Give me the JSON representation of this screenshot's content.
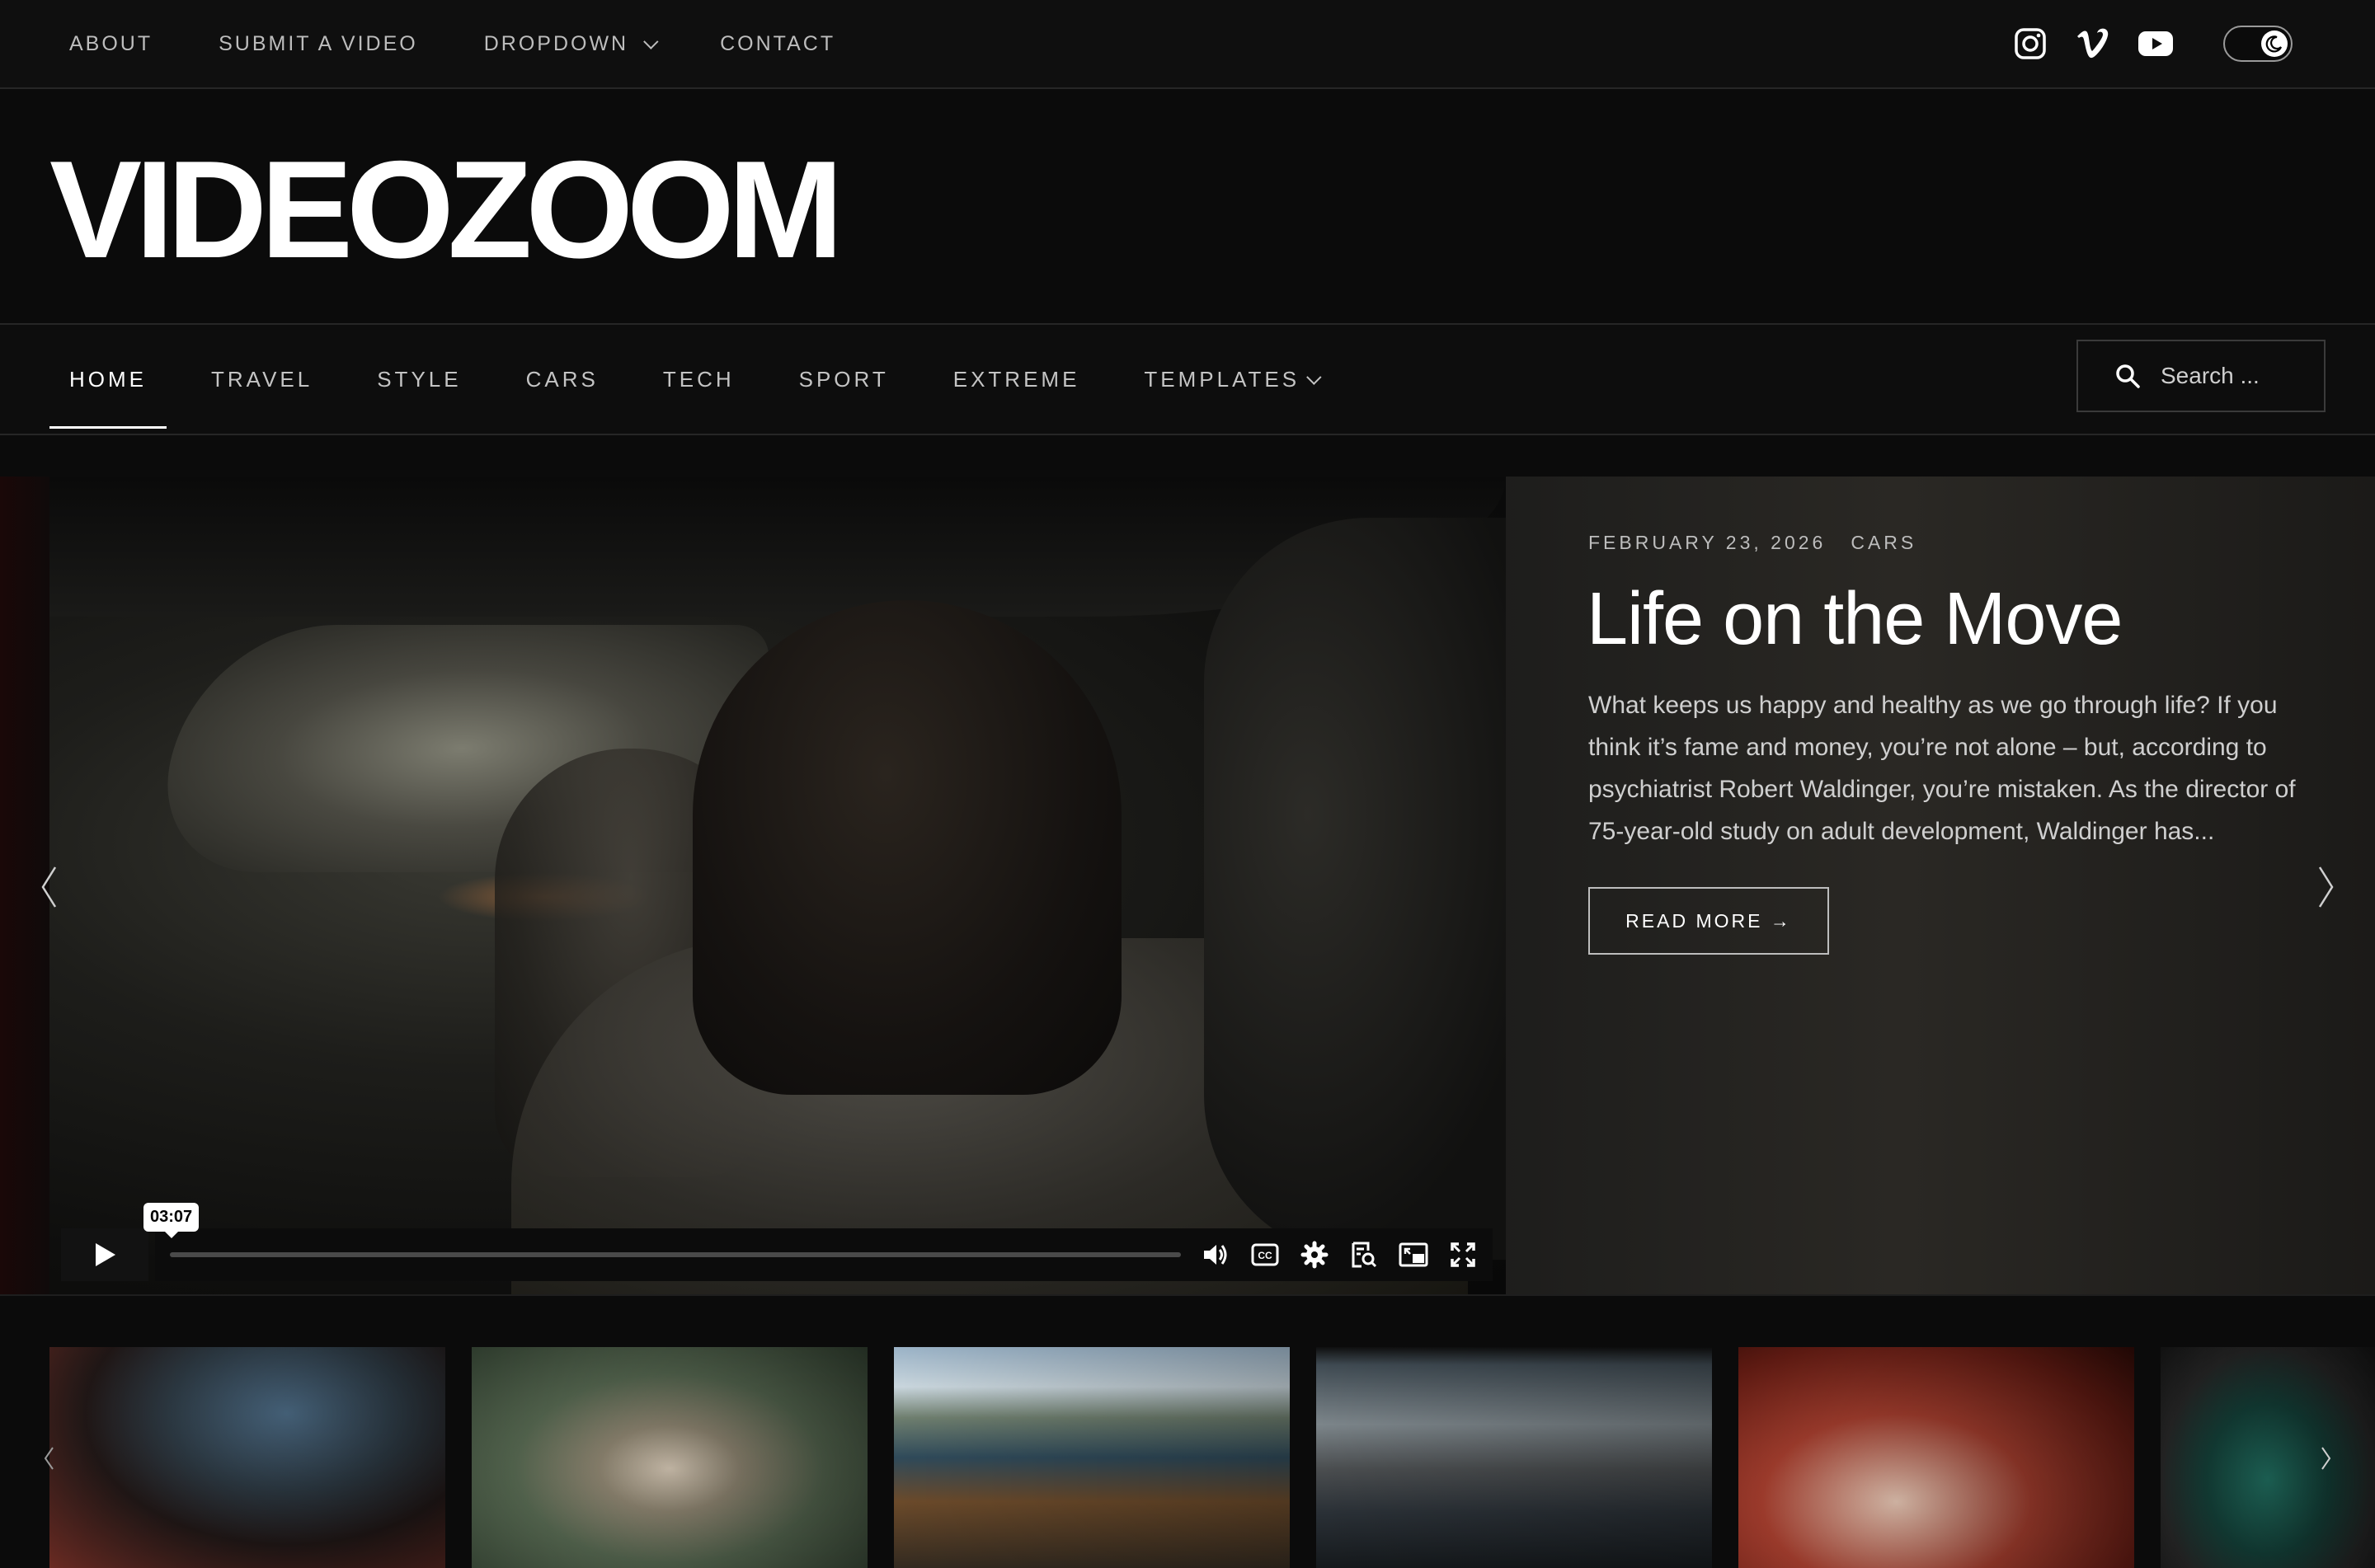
{
  "topnav": {
    "items": [
      {
        "label": "ABOUT"
      },
      {
        "label": "SUBMIT A VIDEO"
      },
      {
        "label": "DROPDOWN"
      },
      {
        "label": "CONTACT"
      }
    ]
  },
  "social": [
    "instagram-icon",
    "vimeo-icon",
    "youtube-icon"
  ],
  "brand": {
    "logo": "VIDEOZOOM"
  },
  "mainnav": {
    "items": [
      {
        "label": "HOME",
        "active": true
      },
      {
        "label": "TRAVEL"
      },
      {
        "label": "STYLE"
      },
      {
        "label": "CARS"
      },
      {
        "label": "TECH"
      },
      {
        "label": "SPORT"
      },
      {
        "label": "EXTREME"
      },
      {
        "label": "TEMPLATES"
      }
    ],
    "search_placeholder": "Search ..."
  },
  "hero": {
    "date": "FEBRUARY 23, 2026",
    "category": "CARS",
    "title": "Life on the Move",
    "excerpt": "What keeps us happy and healthy as we go through life? If you think it’s fame and money, you’re not alone – but, according to psychiatrist Robert Waldinger, you’re mistaken. As the director of 75-year-old study on adult development, Waldinger has...",
    "read_more": "READ MORE →",
    "player": {
      "time_tooltip": "03:07",
      "progress": 0
    }
  },
  "colors": {
    "background": "#0b0b0b",
    "text": "#ffffff",
    "muted": "#bdbdbd",
    "border": "#262626"
  }
}
